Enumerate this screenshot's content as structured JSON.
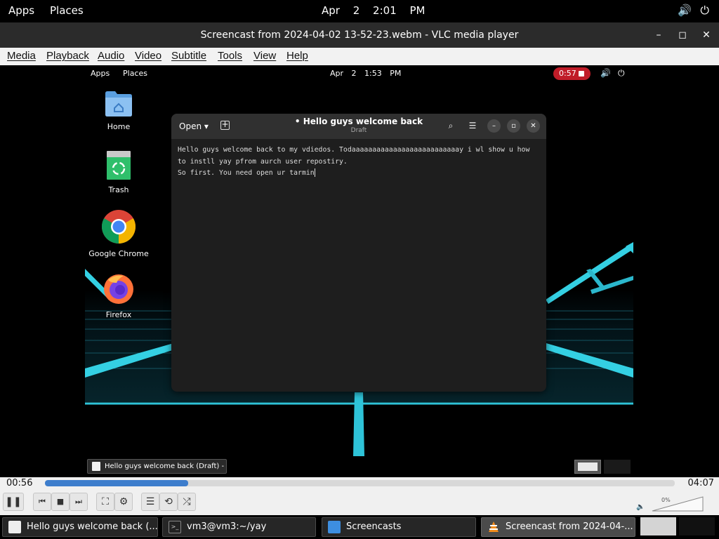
{
  "topbar": {
    "apps": "Apps",
    "places": "Places",
    "date": "Apr 2",
    "time": "2:01 PM",
    "volume_icon": "speaker-icon",
    "power_icon": "power-icon"
  },
  "vlc": {
    "title": "Screencast from 2024-04-02 13-52-23.webm - VLC media player",
    "menu": [
      "Media",
      "Playback",
      "Audio",
      "Video",
      "Subtitle",
      "Tools",
      "View",
      "Help"
    ],
    "elapsed": "00:56",
    "total": "04:07",
    "progress": 0.227,
    "volume": "0%",
    "accent": "#3d7dcc"
  },
  "video": {
    "topbar": {
      "apps": "Apps",
      "places": "Places",
      "date": "Apr 2",
      "time": "1:53 PM",
      "recording": "0:57"
    },
    "desktop": [
      "Home",
      "Trash",
      "Google Chrome",
      "Firefox"
    ],
    "editor": {
      "open_label": "Open",
      "title": "Hello guys welcome back",
      "subtitle": "Draft",
      "lines": [
        "Hello guys welcome back to my vdiedos. Todaaaaaaaaaaaaaaaaaaaaaaaaaay i wl show u how",
        "to instll yay pfrom aurch user repostiry.",
        "So first. You need open ur tarmin"
      ]
    },
    "taskbar_item": "Hello guys welcome back (Draft) - ..."
  },
  "taskbar": {
    "items": [
      "Hello guys welcome back (...",
      "vm3@vm3:~/yay",
      "Screencasts",
      "Screencast from 2024-04-..."
    ]
  }
}
